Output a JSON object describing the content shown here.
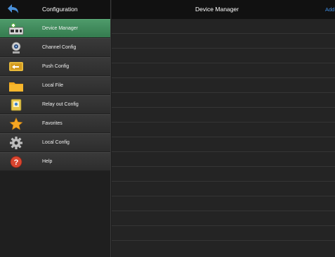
{
  "sidebar": {
    "title": "Configuration",
    "items": [
      {
        "label": "Device Manager",
        "icon": "device-manager-icon",
        "active": true
      },
      {
        "label": "Channel Config",
        "icon": "camera-icon"
      },
      {
        "label": "Push Config",
        "icon": "push-icon"
      },
      {
        "label": "Local File",
        "icon": "folder-icon"
      },
      {
        "label": "Relay out Config",
        "icon": "relay-icon"
      },
      {
        "label": "Favorites",
        "icon": "star-icon"
      },
      {
        "label": "Local Config",
        "icon": "gear-icon"
      },
      {
        "label": "Help",
        "icon": "help-icon"
      }
    ]
  },
  "main": {
    "title": "Device Manager",
    "add_label": "Add"
  },
  "colors": {
    "accent_active": "#3f8a5b",
    "link": "#3f8fe6"
  }
}
